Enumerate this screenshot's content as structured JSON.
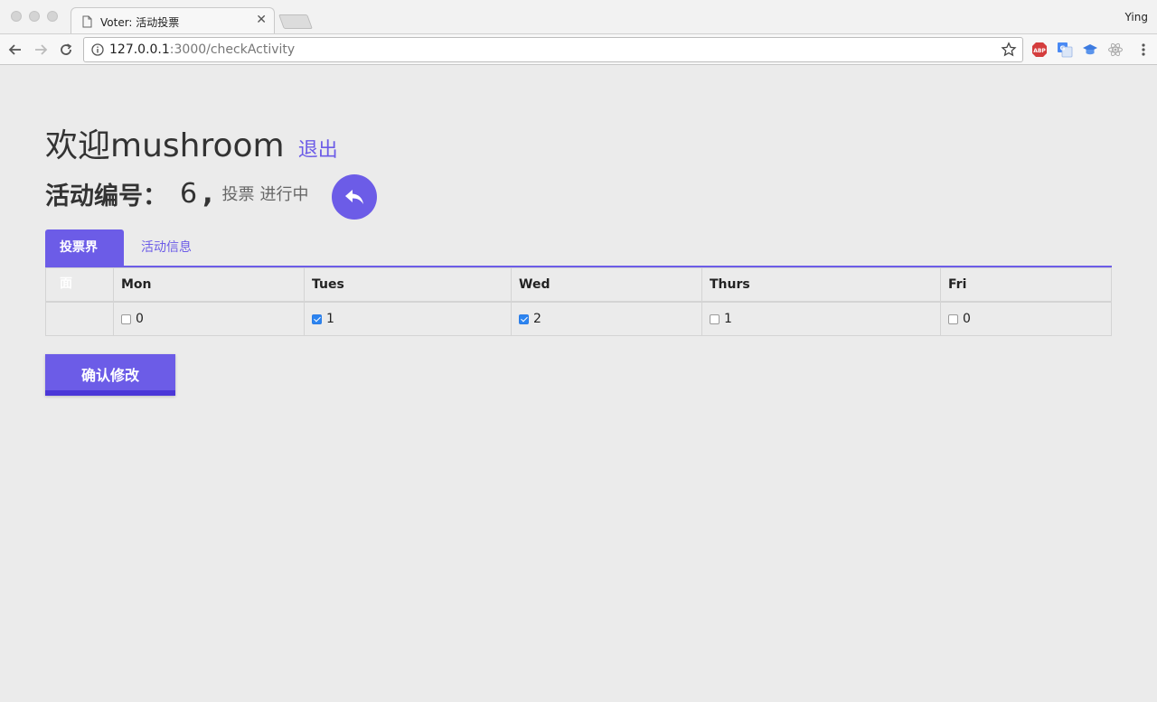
{
  "browser": {
    "tab_title": "Voter: 活动投票",
    "profile_name": "Ying",
    "url_host": "127.0.0.1",
    "url_path": ":3000/checkActivity"
  },
  "page": {
    "welcome_prefix": "欢迎",
    "username": "mushroom",
    "logout_label": "退出",
    "activity_label": "活动编号：",
    "activity_number": "6",
    "activity_comma": ",",
    "activity_type": "投票",
    "activity_status": "进行中",
    "accent_color": "#6c5ce7"
  },
  "tabs": [
    {
      "label": "投票界面",
      "active": true
    },
    {
      "label": "活动信息",
      "active": false
    }
  ],
  "table": {
    "columns": [
      "",
      "Mon",
      "Tues",
      "Wed",
      "Thurs",
      "Fri"
    ],
    "row": [
      {
        "count": "0",
        "checked": false
      },
      {
        "count": "1",
        "checked": true
      },
      {
        "count": "2",
        "checked": true
      },
      {
        "count": "1",
        "checked": false
      },
      {
        "count": "0",
        "checked": false
      }
    ]
  },
  "confirm_label": "确认修改"
}
